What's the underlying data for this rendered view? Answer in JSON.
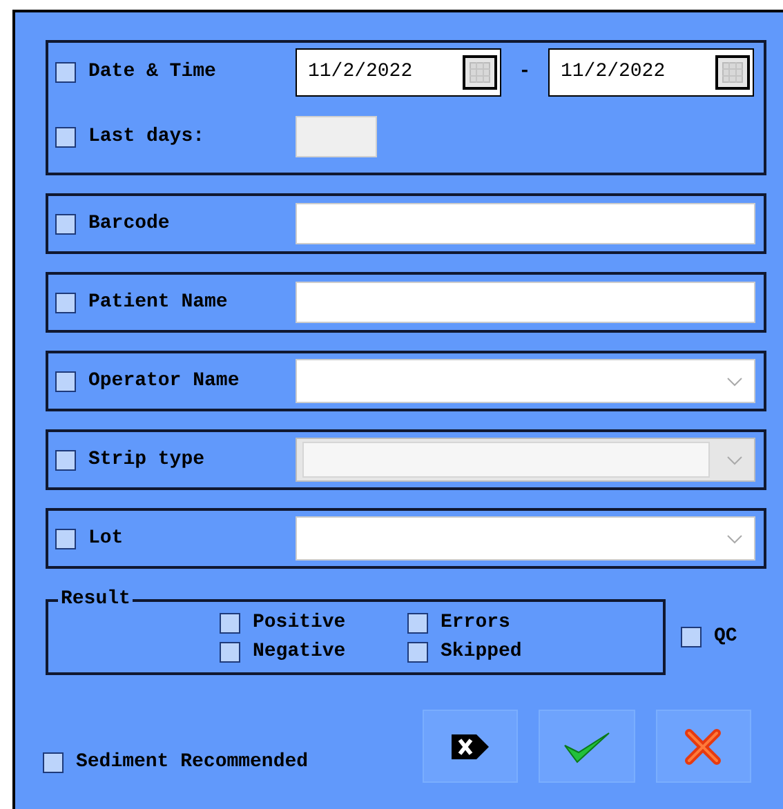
{
  "date_filter": {
    "date_time": {
      "label": "Date & Time",
      "checked": false,
      "from": "11/2/2022",
      "separator": "-",
      "to": "11/2/2022"
    },
    "last_days": {
      "label": "Last days:",
      "checked": false
    }
  },
  "filters": [
    {
      "kind": "text",
      "label": "Barcode",
      "checked": false
    },
    {
      "kind": "text",
      "label": "Patient Name",
      "checked": false
    },
    {
      "kind": "combo",
      "label": "Operator Name",
      "checked": false,
      "disabled": false
    },
    {
      "kind": "combo",
      "label": "Strip type",
      "checked": false,
      "disabled": true
    },
    {
      "kind": "combo",
      "label": "Lot",
      "checked": false,
      "disabled": false
    }
  ],
  "result": {
    "title": "Result",
    "options": [
      {
        "label": "Positive",
        "checked": false
      },
      {
        "label": "Errors",
        "checked": false
      },
      {
        "label": "Negative",
        "checked": false
      },
      {
        "label": "Skipped",
        "checked": false
      }
    ]
  },
  "qc": {
    "label": "QC",
    "checked": false
  },
  "sediment": {
    "label": "Sediment Recommended",
    "checked": false
  },
  "buttons": [
    {
      "kind": "clear"
    },
    {
      "kind": "ok"
    },
    {
      "kind": "cancel"
    }
  ]
}
